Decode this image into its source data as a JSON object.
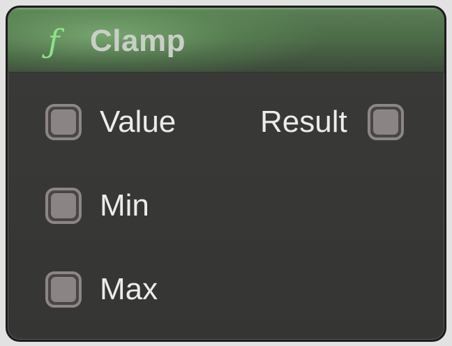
{
  "node": {
    "title": "Clamp",
    "icon": "function-icon",
    "icon_glyph": "ƒ",
    "header_color": "#5a7e55",
    "icon_color": "#8ee08a"
  },
  "inputs": [
    {
      "label": "Value"
    },
    {
      "label": "Min"
    },
    {
      "label": "Max"
    }
  ],
  "outputs": [
    {
      "label": "Result"
    }
  ]
}
